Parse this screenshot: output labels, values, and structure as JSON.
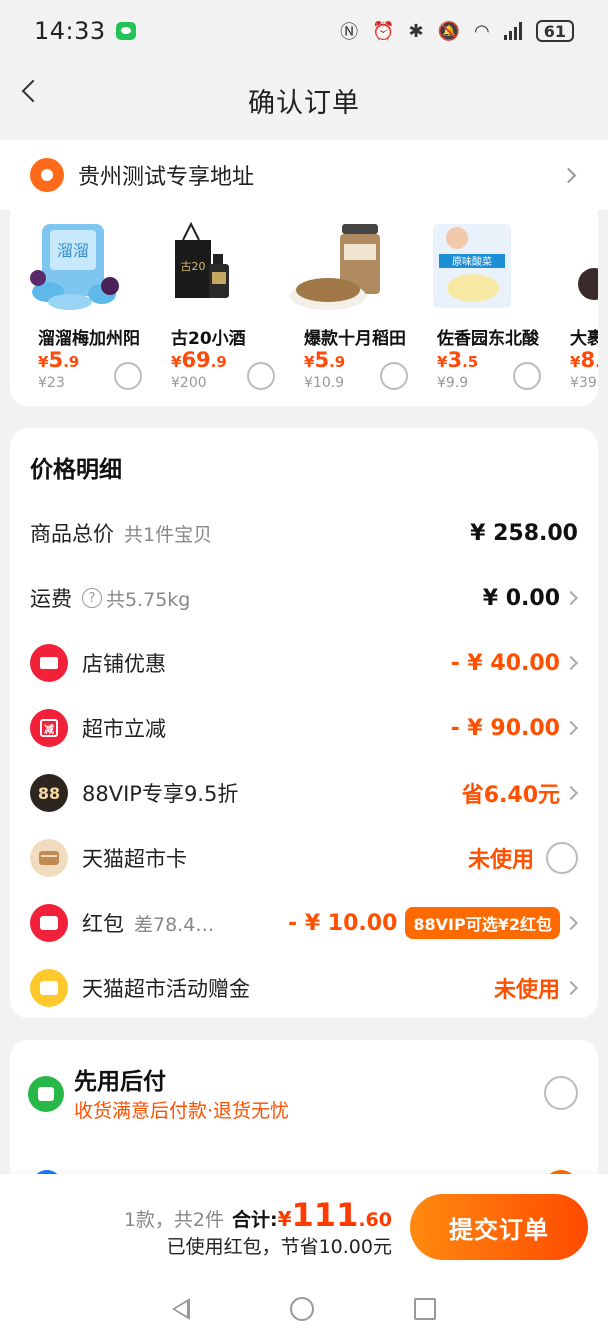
{
  "status_bar": {
    "time": "14:33",
    "battery": "61"
  },
  "header": {
    "title": "确认订单"
  },
  "address": {
    "text": "贵州测试专享地址"
  },
  "goods": [
    {
      "name": "溜溜梅加州阳",
      "price_int": "5",
      "price_dec": ".9",
      "orig": "¥23",
      "img": "plum-snack-bag"
    },
    {
      "name": "古20小酒",
      "price_int": "69",
      "price_dec": ".9",
      "orig": "¥200",
      "img": "liquor-bottle"
    },
    {
      "name": "爆款十月稻田",
      "price_int": "5",
      "price_dec": ".9",
      "orig": "¥10.9",
      "img": "grain-jar"
    },
    {
      "name": "佐香园东北酸",
      "price_int": "3",
      "price_dec": ".5",
      "orig": "¥9.9",
      "img": "pickled-cabbage-bag"
    },
    {
      "name": "大裹",
      "price_int": "8",
      "price_dec": ".",
      "orig": "¥39",
      "img": "dark-fruit"
    }
  ],
  "price_detail": {
    "title": "价格明细",
    "goods_total": {
      "label": "商品总价",
      "sub": "共1件宝贝",
      "value": "¥ 258.00"
    },
    "shipping": {
      "label": "运费",
      "sub": "共5.75kg",
      "value": "¥ 0.00"
    },
    "store_discount": {
      "label": "店铺优惠",
      "value": "- ¥ 40.00"
    },
    "market_cut": {
      "label": "超市立减",
      "value": "- ¥ 90.00",
      "icon_text": "减"
    },
    "vip": {
      "label": "88VIP专享9.5折",
      "value": "省6.40元",
      "icon_text": "88"
    },
    "market_card": {
      "label": "天猫超市卡",
      "value": "未使用"
    },
    "red_packet": {
      "label": "红包",
      "sub": "差78.4…",
      "value": "- ¥ 10.00",
      "badge": "88VIP可选¥2红包"
    },
    "activity_gift": {
      "label": "天猫超市活动赠金",
      "value": "未使用"
    }
  },
  "pay_later": {
    "title": "先用后付",
    "subtitle": "收货满意后付款·退货无忧"
  },
  "bottom": {
    "count": "1款，共2件",
    "total_label": "合计:",
    "yen": "¥",
    "total_int": "111",
    "total_dec": ".60",
    "saved": "已使用红包，节省10.00元",
    "submit": "提交订单"
  },
  "colors": {
    "accent": "#ff5000",
    "address_pin": "#ff6a1a",
    "submit_gradient_start": "#ff8a10",
    "submit_gradient_end": "#ff4a00"
  }
}
